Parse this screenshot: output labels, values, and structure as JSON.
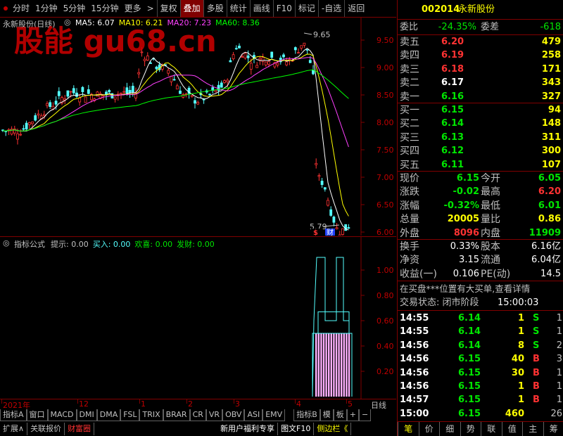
{
  "toolbar": {
    "items": [
      "分时",
      "1分钟",
      "5分钟",
      "15分钟",
      "更多",
      ">",
      "复权",
      "叠加",
      "多股",
      "统计",
      "画线",
      "F10",
      "标记",
      "-自选",
      "返回"
    ]
  },
  "chart": {
    "title": "永新股份(日线)",
    "ma": [
      {
        "label": "MA5: 6.07",
        "color": "#ffffff"
      },
      {
        "label": "MA10: 6.21",
        "color": "#ffff00"
      },
      {
        "label": "MA20: 7.23",
        "color": "#ff40ff"
      },
      {
        "label": "MA60: 8.36",
        "color": "#00ff00"
      }
    ],
    "watermark": "股能 gu68.cn",
    "high_label": "9.65",
    "low_label": "5.79",
    "y_ticks": [
      "9.50",
      "9.00",
      "8.50",
      "8.00",
      "7.50",
      "7.00",
      "6.50",
      "6.00"
    ],
    "markers": [
      "$",
      "财"
    ]
  },
  "indicator": {
    "title": "指标公式",
    "legend": [
      {
        "label": "提示: 0.00",
        "color": "#c0c0c0"
      },
      {
        "label": "买入: 0.00",
        "color": "#54ffff"
      },
      {
        "label": "欢喜: 0.00",
        "color": "#00e600"
      },
      {
        "label": "发财: 0.00",
        "color": "#00e600"
      }
    ],
    "y_ticks": [
      "1.00",
      "0.80",
      "0.60",
      "0.40",
      "0.20"
    ]
  },
  "time_axis": {
    "labels": [
      "2021年",
      "12",
      "1",
      "2",
      "3",
      "4",
      "5"
    ],
    "right": "日线"
  },
  "tabs1": [
    "指标A",
    "窗口",
    "MACD",
    "DMI",
    "DMA",
    "FSL",
    "TRIX",
    "BRAR",
    "CR",
    "VR",
    "OBV",
    "ASI",
    "EMV",
    "指标B",
    "模",
    "板",
    "+",
    "−"
  ],
  "tabs2": [
    "扩展∧",
    "关联报价",
    "财富圈",
    "新用户福利专享",
    "图文F10",
    "侧边栏《"
  ],
  "quote": {
    "code": "002014",
    "name": "永新股份",
    "weibi_label": "委比",
    "weibi": "-24.35%",
    "weicha_label": "委差",
    "weicha": "-618",
    "sell": [
      {
        "label": "卖五",
        "price": "6.20",
        "vol": "479"
      },
      {
        "label": "卖四",
        "price": "6.19",
        "vol": "258"
      },
      {
        "label": "卖三",
        "price": "6.18",
        "vol": "171"
      },
      {
        "label": "卖二",
        "price": "6.17",
        "vol": "343"
      },
      {
        "label": "卖一",
        "price": "6.16",
        "vol": "327"
      }
    ],
    "buy": [
      {
        "label": "买一",
        "price": "6.15",
        "vol": "94"
      },
      {
        "label": "买二",
        "price": "6.14",
        "vol": "148"
      },
      {
        "label": "买三",
        "price": "6.13",
        "vol": "311"
      },
      {
        "label": "买四",
        "price": "6.12",
        "vol": "300"
      },
      {
        "label": "买五",
        "price": "6.11",
        "vol": "107"
      }
    ],
    "stats": [
      {
        "l1": "现价",
        "v1": "6.15",
        "l2": "今开",
        "v2": "6.05"
      },
      {
        "l1": "涨跌",
        "v1": "-0.02",
        "l2": "最高",
        "v2": "6.20"
      },
      {
        "l1": "涨幅",
        "v1": "-0.32%",
        "l2": "最低",
        "v2": "6.01"
      },
      {
        "l1": "总量",
        "v1": "20005",
        "l2": "量比",
        "v2": "0.86"
      },
      {
        "l1": "外盘",
        "v1": "8096",
        "l2": "内盘",
        "v2": "11909"
      }
    ],
    "fin": [
      {
        "l1": "换手",
        "v1": "0.33%",
        "l2": "股本",
        "v2": "6.16亿"
      },
      {
        "l1": "净资",
        "v1": "3.15",
        "l2": "流通",
        "v2": "6.04亿"
      },
      {
        "l1": "收益(一)",
        "v1": "0.106",
        "l2": "PE(动)",
        "v2": "14.5"
      }
    ],
    "notice": "在买盘***位置有大买单,查看详情",
    "status_label": "交易状态: 闭市阶段",
    "status_time": "15:00:03",
    "ticks": [
      {
        "t": "14:55",
        "p": "6.14",
        "v": "1",
        "s": "S",
        "n": "1"
      },
      {
        "t": "14:55",
        "p": "6.14",
        "v": "1",
        "s": "S",
        "n": "1"
      },
      {
        "t": "14:56",
        "p": "6.14",
        "v": "8",
        "s": "S",
        "n": "2"
      },
      {
        "t": "14:56",
        "p": "6.15",
        "v": "40",
        "s": "B",
        "n": "3"
      },
      {
        "t": "14:56",
        "p": "6.15",
        "v": "30",
        "s": "B",
        "n": "1"
      },
      {
        "t": "14:56",
        "p": "6.15",
        "v": "1",
        "s": "B",
        "n": "1"
      },
      {
        "t": "14:57",
        "p": "6.15",
        "v": "1",
        "s": "B",
        "n": "1"
      },
      {
        "t": "15:00",
        "p": "6.15",
        "v": "460",
        "s": "",
        "n": "26"
      }
    ],
    "tabs": [
      "笔",
      "价",
      "细",
      "势",
      "联",
      "值",
      "主",
      "筹"
    ]
  }
}
